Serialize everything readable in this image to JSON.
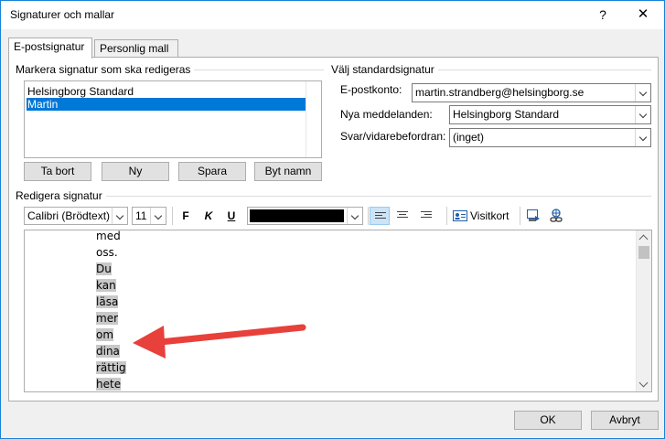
{
  "window": {
    "title": "Signaturer och mallar",
    "help_label": "?",
    "close_label": "✕"
  },
  "tabs": [
    {
      "label": "E-postsignatur",
      "active": true
    },
    {
      "label": "Personlig mall",
      "active": false
    }
  ],
  "edit_group": {
    "label": "Markera signatur som ska redigeras",
    "items": [
      {
        "label": "Helsingborg Standard",
        "selected": false
      },
      {
        "label": "Martin",
        "selected": true
      }
    ],
    "buttons": {
      "delete": "Ta bort",
      "new": "Ny",
      "save": "Spara",
      "rename": "Byt namn"
    }
  },
  "default_group": {
    "label": "Välj standardsignatur",
    "account_label": "E-postkonto:",
    "account_value": "martin.strandberg@helsingborg.se",
    "new_messages_label": "Nya meddelanden:",
    "new_messages_value": "Helsingborg Standard",
    "reply_label": "Svar/vidarebefordran:",
    "reply_value": "(inget)"
  },
  "editor": {
    "group_label": "Redigera signatur",
    "font_name": "Calibri (Brödtext)",
    "font_size": "11",
    "bold": "F",
    "italic": "K",
    "underline": "U",
    "font_color": "#000000",
    "business_card_label": "Visitkort",
    "lines": [
      {
        "text": "med",
        "highlighted": false
      },
      {
        "text": "oss.",
        "highlighted": false
      },
      {
        "text": "Du",
        "highlighted": true
      },
      {
        "text": "kan",
        "highlighted": true
      },
      {
        "text": "läsa",
        "highlighted": true
      },
      {
        "text": "mer",
        "highlighted": true
      },
      {
        "text": "om",
        "highlighted": true
      },
      {
        "text": "dina",
        "highlighted": true
      },
      {
        "text": "rättig",
        "highlighted": true
      },
      {
        "text": "hete",
        "highlighted": true
      }
    ]
  },
  "footer": {
    "ok": "OK",
    "cancel": "Avbryt"
  },
  "colors": {
    "selection": "#0078d7",
    "annotation_arrow": "#e8403a",
    "text_highlight": "#c8c8c8"
  }
}
